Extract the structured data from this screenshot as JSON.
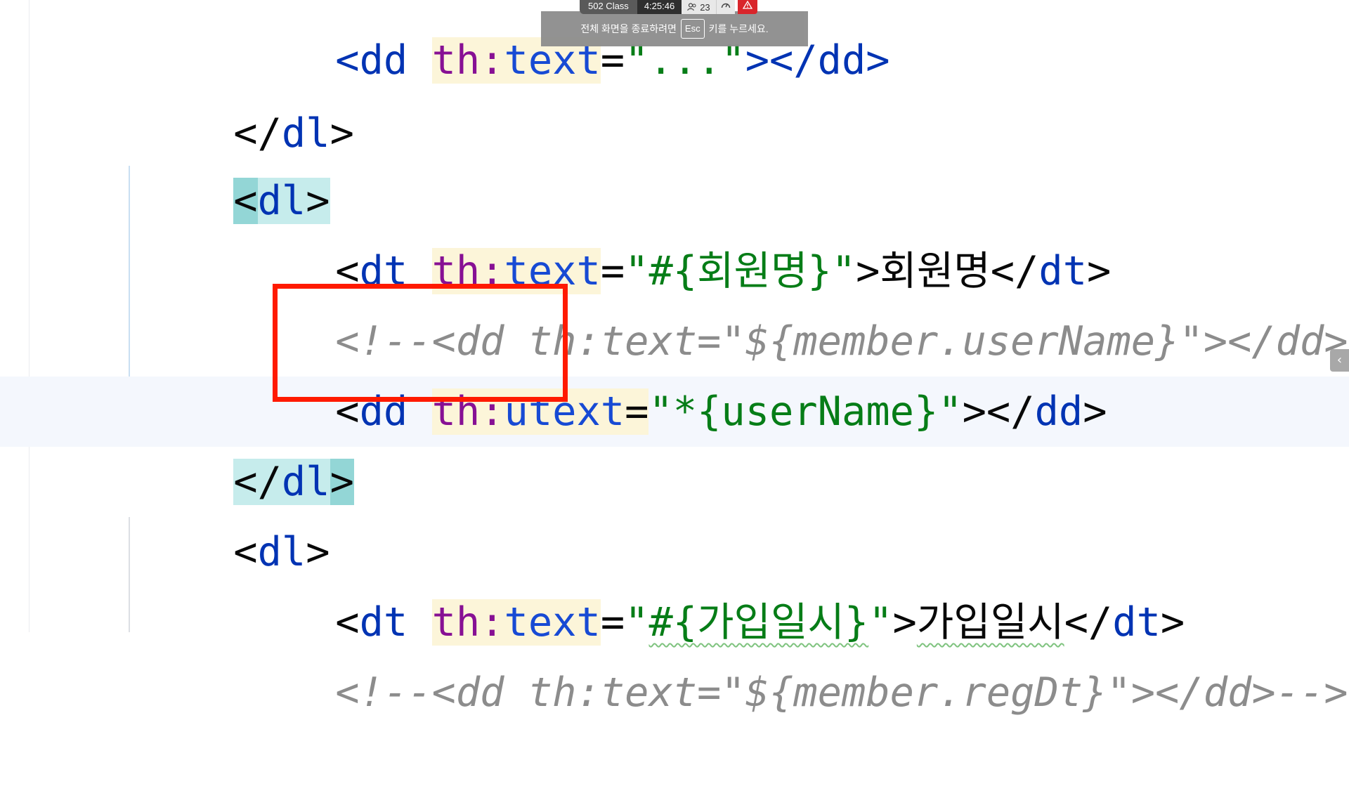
{
  "overlay": {
    "message_before": "전체 화면을 종료하려면",
    "key": "Esc",
    "message_after": "키를 누르세요."
  },
  "statusbar": {
    "class_name": "502 Class",
    "time": "4:25:46",
    "user_icon": "users-icon",
    "user_count": "23",
    "gauge_icon": "gauge-icon",
    "alert_icon": "alert-triangle-icon",
    "accent": "#d9252b"
  },
  "editor": {
    "lines": [
      {
        "p1": "<dd ",
        "ns": "th:",
        "attr": "text",
        "eq": "=",
        "val": "\"...\"",
        "rest": "></dd>"
      },
      {
        "open": "</",
        "tag": "dl",
        "close": ">"
      },
      {
        "open": "<",
        "tag": "dl",
        "close": ">"
      },
      {
        "p1": "<",
        "tag": "dt",
        "ns": "th:",
        "attr": "text",
        "eq": "=",
        "q1": "\"",
        "val": "#{회원명}",
        "q2": "\"",
        "gt": ">",
        "text": "회원명",
        "end_open": "</",
        "end_tag": "dt",
        "end_close": ">"
      },
      {
        "comment": "<!--<dd th:text=\"${member.userName}\"></dd>--"
      },
      {
        "p1": "<",
        "tag": "dd",
        "ns": "th:",
        "attr": "utext",
        "eq": "=",
        "q1": "\"",
        "val": "*{userName}",
        "q2": "\"",
        "gt": "></",
        "end_tag": "dd",
        "end_close": ">"
      },
      {
        "open": "</",
        "tag": "dl",
        "close": ">"
      },
      {
        "open": "<",
        "tag": "dl",
        "close": ">"
      },
      {
        "p1": "<",
        "tag": "dt",
        "ns": "th:",
        "attr": "text",
        "eq": "=",
        "q1": "\"",
        "val": "#{가입일시}",
        "q2": "\"",
        "gt": ">",
        "text": "가입일시",
        "end_open": "</",
        "end_tag": "dt",
        "end_close": ">"
      },
      {
        "comment": "<!--<dd th:text=\"${member.regDt}\"></dd>-->"
      }
    ]
  },
  "collapse_icon": "chevron-left-icon",
  "annotation_color": "#ff1a00"
}
